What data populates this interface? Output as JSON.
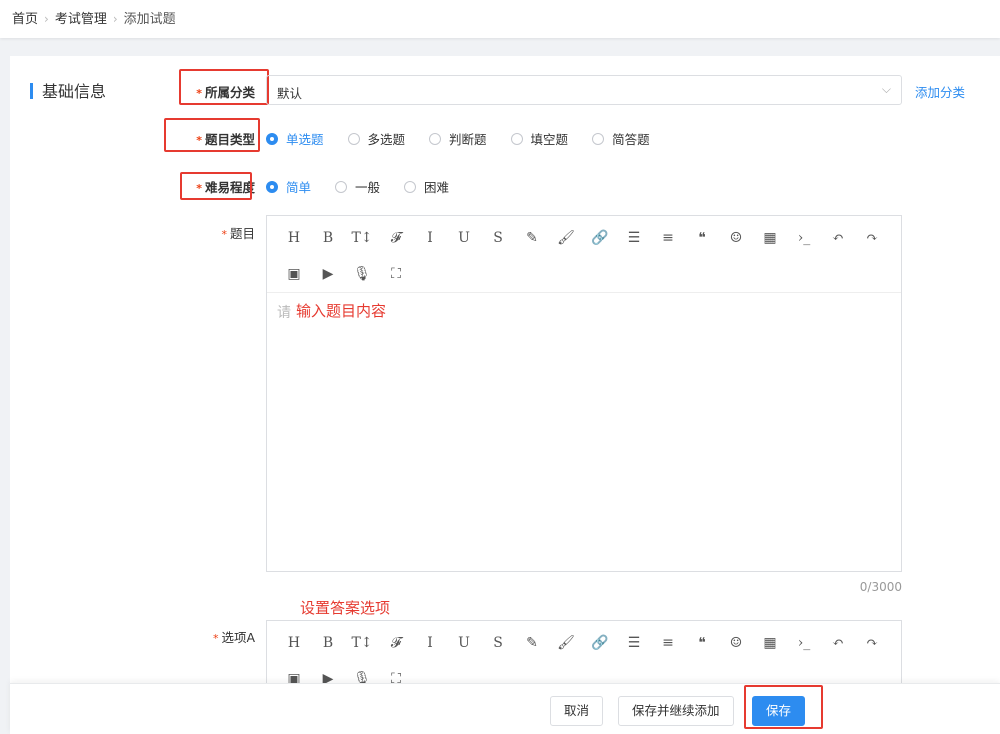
{
  "breadcrumb": {
    "home": "首页",
    "section": "考试管理",
    "current": "添加试题"
  },
  "section_title": "基础信息",
  "category": {
    "label": "所属分类",
    "value": "默认",
    "add_link": "添加分类"
  },
  "question_type": {
    "label": "题目类型",
    "options": [
      "单选题",
      "多选题",
      "判断题",
      "填空题",
      "简答题"
    ],
    "selected": "单选题"
  },
  "difficulty": {
    "label": "难易程度",
    "options": [
      "简单",
      "一般",
      "困难"
    ],
    "selected": "简单"
  },
  "question": {
    "label": "题目",
    "placeholder": "请",
    "annotation": "输入题目内容",
    "counter": "0/3000"
  },
  "toolbar_row1": [
    "H",
    "B",
    "T↕",
    "𝓕",
    "I",
    "U",
    "S",
    "✎",
    "🖌",
    "🔗",
    "☰",
    "≡",
    "❝",
    "☺",
    "▦",
    "›_"
  ],
  "toolbar_row2": [
    "↶",
    "↷",
    "▣",
    "▶",
    "🎙",
    "⛶"
  ],
  "option_a": {
    "label": "选项A",
    "annotation": "设置答案选项"
  },
  "buttons": {
    "cancel": "取消",
    "save_continue": "保存并继续添加",
    "save": "保存"
  },
  "colors": {
    "accent": "#2d8cf0",
    "required": "#ed4014",
    "annotation": "#e63a30"
  }
}
